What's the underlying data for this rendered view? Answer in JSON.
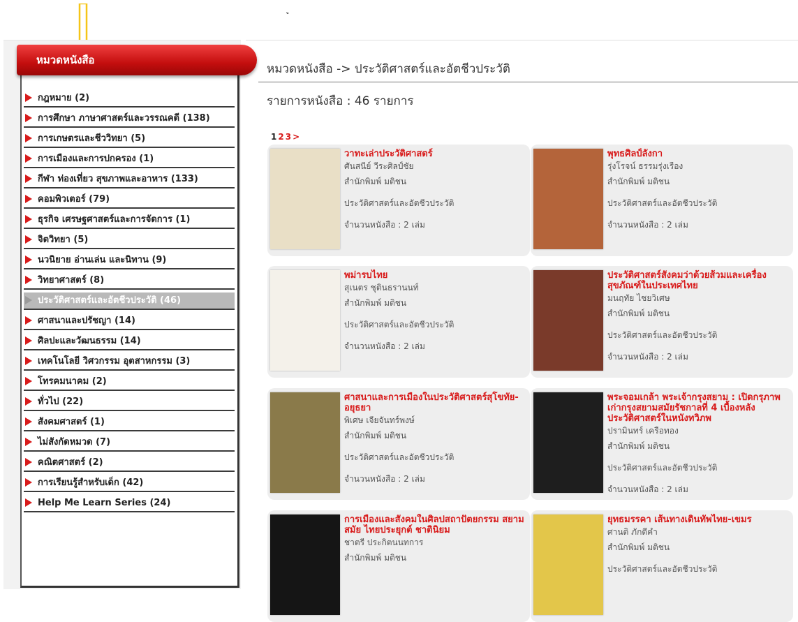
{
  "top_mark": "ู",
  "sidebar": {
    "header": "หมวดหนังสือ",
    "items": [
      {
        "label": "กฎหมาย (2)"
      },
      {
        "label": "การศึกษา ภาษาศาสตร์และวรรณคดี (138)"
      },
      {
        "label": "การเกษตรและชีววิทยา (5)"
      },
      {
        "label": "การเมืองและการปกครอง (1)"
      },
      {
        "label": "กีฬา ท่องเที่ยว สุขภาพและอาหาร (133)"
      },
      {
        "label": "คอมพิวเตอร์ (79)"
      },
      {
        "label": "ธุรกิจ เศรษฐศาสตร์และการจัดการ (1)"
      },
      {
        "label": "จิตวิทยา (5)"
      },
      {
        "label": "นวนิยาย อ่านเล่น และนิทาน (9)"
      },
      {
        "label": "วิทยาศาสตร์ (8)"
      },
      {
        "label": "ประวัติศาสตร์และอัตชีวประวัติ (46)",
        "active": true
      },
      {
        "label": "ศาสนาและปรัชญา (14)"
      },
      {
        "label": "ศิลปะและวัฒนธรรม (14)"
      },
      {
        "label": "เทคโนโลยี วิศวกรรม อุตสาหกรรม (3)"
      },
      {
        "label": "โทรคมนาคม (2)"
      },
      {
        "label": "ทั่วไป (22)"
      },
      {
        "label": "สังคมศาสตร์ (1)"
      },
      {
        "label": "ไม่สังกัดหมวด (7)"
      },
      {
        "label": "คณิตศาสตร์ (2)"
      },
      {
        "label": "การเรียนรู้สำหรับเด็ก (42)"
      },
      {
        "label": "Help Me Learn Series (24)"
      }
    ]
  },
  "main": {
    "breadcrumb": "หมวดหนังสือ -> ประวัติศาสตร์และอัตชีวประวัติ",
    "count": "รายการหนังสือ : 46 รายการ",
    "pager": {
      "current": "1",
      "pages": [
        "2",
        "3",
        ">"
      ]
    },
    "books": [
      {
        "title": "วาทะเล่าประวัติศาสตร์",
        "author": "ศันสนีย์ วีระศิลป์ชัย",
        "publisher": "สำนักพิมพ์ มติชน",
        "category": "ประวัติศาสตร์และอัตชีวประวัติ",
        "quantity": "จำนวนหนังสือ : 2 เล่ม",
        "cover_color": "#e9dfc6"
      },
      {
        "title": "พุทธศิลป์ลังกา",
        "author": "รุ่งโรจน์ ธรรมรุ่งเรือง",
        "publisher": "สำนักพิมพ์ มติชน",
        "category": "ประวัติศาสตร์และอัตชีวประวัติ",
        "quantity": "จำนวนหนังสือ : 2 เล่ม",
        "cover_color": "#b4643a"
      },
      {
        "title": "พม่ารบไทย",
        "author": "สุเนตร ชุตินธรานนท์",
        "publisher": "สำนักพิมพ์ มติชน",
        "category": "ประวัติศาสตร์และอัตชีวประวัติ",
        "quantity": "จำนวนหนังสือ : 2 เล่ม",
        "cover_color": "#f4f1ea"
      },
      {
        "title": "ประวัติศาสตร์สังคมว่าด้วยส้วมและเครื่องสุขภัณฑ์ในประเทศไทย",
        "author": "มนฤทัย ไชยวิเศษ",
        "publisher": "สำนักพิมพ์ มติชน",
        "category": "ประวัติศาสตร์และอัตชีวประวัติ",
        "quantity": "จำนวนหนังสือ : 2 เล่ม",
        "cover_color": "#7a3a2a"
      },
      {
        "title": "ศาสนาและการเมืองในประวัติศาสตร์สุโขทัย-อยุธยา",
        "author": "พิเศษ เจียจันทร์พงษ์",
        "publisher": "สำนักพิมพ์ มติชน",
        "category": "ประวัติศาสตร์และอัตชีวประวัติ",
        "quantity": "จำนวนหนังสือ : 2 เล่ม",
        "cover_color": "#8a7a4a"
      },
      {
        "title": "พระจอมเกล้า พระเจ้ากรุงสยาม : เปิดกรุภาพเก่ากรุงสยามสมัยรัชกาลที่ 4 เบื้องหลังประวัติศาสตร์ในหนังทวิภพ",
        "author": "ปรามินทร์ เครือทอง",
        "publisher": "สำนักพิมพ์ มติชน",
        "category": "ประวัติศาสตร์และอัตชีวประวัติ",
        "quantity": "จำนวนหนังสือ : 2 เล่ม",
        "cover_color": "#1e1e1e"
      },
      {
        "title": "การเมืองและสังคมในศิลปสถาปัตยกรรม สยามสมัย ไทยประยุกต์ ชาตินิยม",
        "author": "ชาตรี ประกิตนนทการ",
        "publisher": "สำนักพิมพ์ มติชน",
        "category": "",
        "quantity": "",
        "cover_color": "#151515"
      },
      {
        "title": "ยุทธมรรคา เส้นทางเดินทัพไทย-เขมร",
        "author": "ศานติ ภักดีคำ",
        "publisher": "สำนักพิมพ์ มติชน",
        "category": "ประวัติศาสตร์และอัตชีวประวัติ",
        "quantity": "",
        "cover_color": "#e3c64a"
      }
    ]
  },
  "colors": {
    "accent": "#d81b1b",
    "header_red": "#c40e0e",
    "arrow": "#f5c518",
    "card_bg": "#eeeeee"
  }
}
